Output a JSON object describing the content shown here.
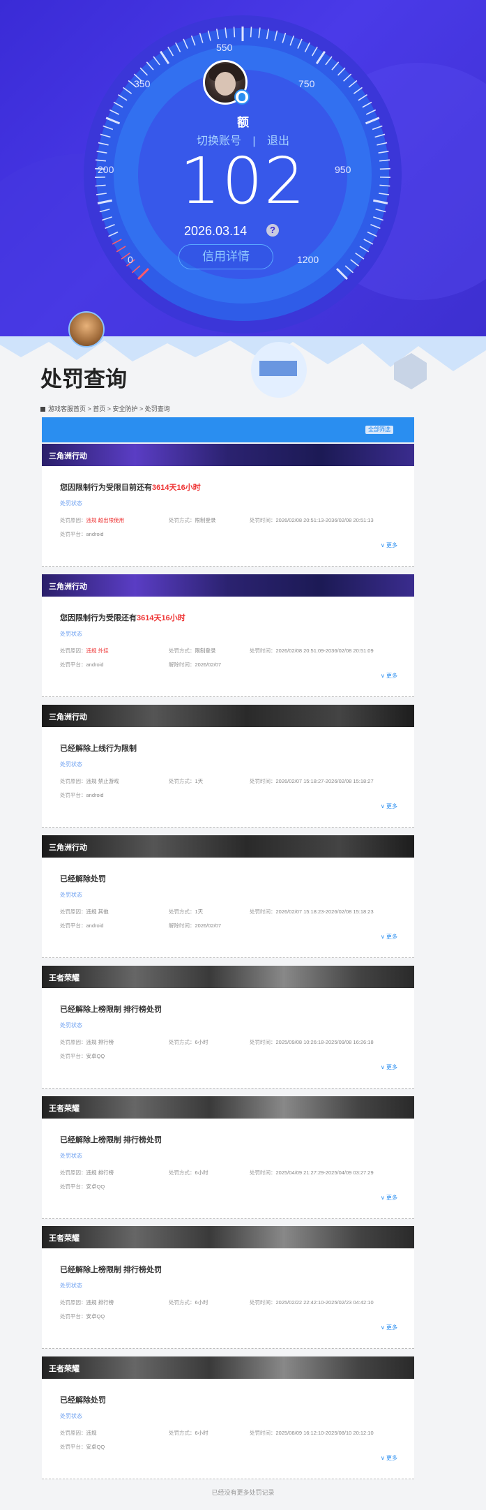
{
  "hero": {
    "tick_labels": [
      "0",
      "200",
      "350",
      "550",
      "750",
      "950",
      "1200"
    ],
    "username": "额",
    "switch_account": "切换账号",
    "separator": "|",
    "logout": "退出",
    "score": "102",
    "date": "2026.03.14",
    "help": "?",
    "credit_detail": "信用详情"
  },
  "page": {
    "title": "处罚查询",
    "breadcrumb": "游戏客服首页 > 首页 > 安全防护 > 处罚查询",
    "top_button": "全部筛选"
  },
  "cards": [
    {
      "game": "三角洲行动",
      "title_prefix": "您因限制行为受限目前还有",
      "title_highlight": "3614天16小时",
      "status": "处罚状态",
      "r1": [
        {
          "k": "处罚原因：",
          "v": "违规 超出限使用",
          "red": true
        },
        {
          "k": "处罚方式：",
          "v": "限制登录"
        },
        {
          "k": "处罚时间：",
          "v": "2026/02/08 20:51:13-2036/02/08 20:51:13"
        }
      ],
      "r2": [
        {
          "k": "处罚平台：",
          "v": "android"
        }
      ],
      "more": "更多"
    },
    {
      "game": "三角洲行动",
      "title_prefix": "您因限制行为受限还有",
      "title_highlight": "3614天16小时",
      "status": "处罚状态",
      "r1": [
        {
          "k": "处罚原因：",
          "v": "违规 外挂",
          "red": true
        },
        {
          "k": "处罚方式：",
          "v": "限制登录"
        },
        {
          "k": "处罚时间：",
          "v": "2026/02/08 20:51:09-2036/02/08 20:51:09"
        }
      ],
      "r2": [
        {
          "k": "处罚平台：",
          "v": "android"
        },
        {
          "k": "解除时间：",
          "v": "2026/02/07"
        }
      ],
      "more": "更多"
    },
    {
      "game": "三角洲行动",
      "title_prefix": "已经解除上线行为限制",
      "title_highlight": "",
      "status": "处罚状态",
      "r1": [
        {
          "k": "处罚原因：",
          "v": "违规 禁止游戏"
        },
        {
          "k": "处罚方式：",
          "v": "1天"
        },
        {
          "k": "处罚时间：",
          "v": "2026/02/07 15:18:27-2026/02/08 15:18:27"
        }
      ],
      "r2": [
        {
          "k": "处罚平台：",
          "v": "android"
        }
      ],
      "more": "更多"
    },
    {
      "game": "三角洲行动",
      "title_prefix": "已经解除处罚",
      "title_highlight": "",
      "status": "处罚状态",
      "r1": [
        {
          "k": "处罚原因：",
          "v": "违规 其他"
        },
        {
          "k": "处罚方式：",
          "v": "1天"
        },
        {
          "k": "处罚时间：",
          "v": "2026/02/07 15:18:23-2026/02/08 15:18:23"
        }
      ],
      "r2": [
        {
          "k": "处罚平台：",
          "v": "android"
        },
        {
          "k": "解除时间：",
          "v": "2026/02/07"
        }
      ],
      "more": "更多"
    },
    {
      "game": "王者荣耀",
      "title_prefix": "已经解除上榜限制 排行榜处罚",
      "title_highlight": "",
      "status": "处罚状态",
      "r1": [
        {
          "k": "处罚原因：",
          "v": "违规 排行榜"
        },
        {
          "k": "处罚方式：",
          "v": "6小时"
        },
        {
          "k": "处罚时间：",
          "v": "2025/09/08 10:26:18-2025/09/08 16:26:18"
        }
      ],
      "r2": [
        {
          "k": "处罚平台：",
          "v": "安卓QQ"
        }
      ],
      "more": "更多"
    },
    {
      "game": "王者荣耀",
      "title_prefix": "已经解除上榜限制 排行榜处罚",
      "title_highlight": "",
      "status": "处罚状态",
      "r1": [
        {
          "k": "处罚原因：",
          "v": "违规 排行榜"
        },
        {
          "k": "处罚方式：",
          "v": "6小时"
        },
        {
          "k": "处罚时间：",
          "v": "2025/04/09 21:27:29-2025/04/09 03:27:29"
        }
      ],
      "r2": [
        {
          "k": "处罚平台：",
          "v": "安卓QQ"
        }
      ],
      "more": "更多"
    },
    {
      "game": "王者荣耀",
      "title_prefix": "已经解除上榜限制 排行榜处罚",
      "title_highlight": "",
      "status": "处罚状态",
      "r1": [
        {
          "k": "处罚原因：",
          "v": "违规 排行榜"
        },
        {
          "k": "处罚方式：",
          "v": "6小时"
        },
        {
          "k": "处罚时间：",
          "v": "2025/02/22 22:42:10-2025/02/23 04:42:10"
        }
      ],
      "r2": [
        {
          "k": "处罚平台：",
          "v": "安卓QQ"
        }
      ],
      "more": "更多"
    },
    {
      "game": "王者荣耀",
      "title_prefix": "已经解除处罚",
      "title_highlight": "",
      "status": "处罚状态",
      "r1": [
        {
          "k": "处罚原因：",
          "v": "违规"
        },
        {
          "k": "处罚方式：",
          "v": "6小时"
        },
        {
          "k": "处罚时间：",
          "v": "2025/08/09 16:12:10-2025/08/10 20:12:10"
        }
      ],
      "r2": [
        {
          "k": "处罚平台：",
          "v": "安卓QQ"
        }
      ],
      "more": "更多"
    }
  ],
  "footer": "已经没有更多处罚记录"
}
